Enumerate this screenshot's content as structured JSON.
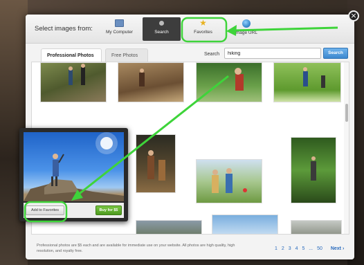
{
  "header": {
    "select_label": "Select images from:",
    "sources": [
      {
        "label": "My Computer",
        "icon": "monitor-icon"
      },
      {
        "label": "Search",
        "icon": "search-icon",
        "active": true
      },
      {
        "label": "Favorites",
        "icon": "star-icon"
      },
      {
        "label": "Image URL",
        "icon": "globe-icon"
      }
    ]
  },
  "tabs": [
    {
      "label": "Professional Photos",
      "active": true
    },
    {
      "label": "Free Photos",
      "active": false
    }
  ],
  "search": {
    "label": "Search",
    "value": "hiking",
    "button_label": "Search"
  },
  "preview": {
    "add_favorites_label": "Add to Favorites",
    "buy_label": "Buy for $5"
  },
  "footer": {
    "note": "Professional photos are $5 each and are available for immediate use on your website. All photos are high quality, high resolution, and royalty free.",
    "pages": [
      "1",
      "2",
      "3",
      "4",
      "5",
      "...",
      "50"
    ],
    "next_label": "Next ›"
  },
  "colors": {
    "highlight": "#3ed43a",
    "search_button": "#3d88cf",
    "buy_button": "#4e9a1f",
    "link": "#2a6bbd"
  }
}
